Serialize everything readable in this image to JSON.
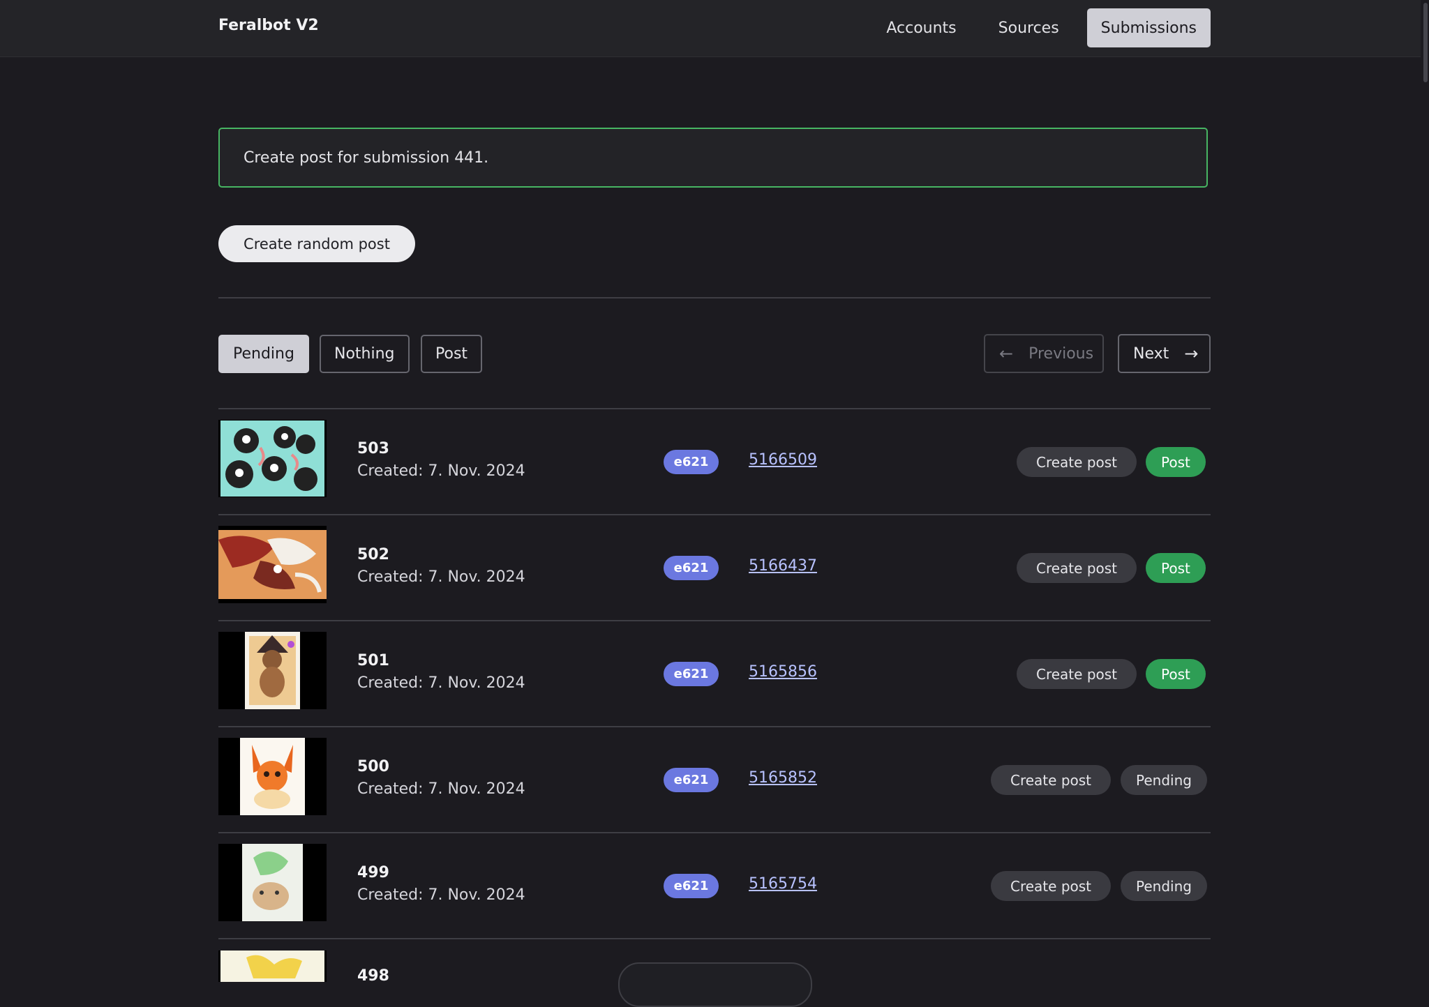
{
  "app": {
    "title": "Feralbot V2"
  },
  "nav": [
    {
      "label": "Accounts",
      "active": false
    },
    {
      "label": "Sources",
      "active": false
    },
    {
      "label": "Submissions",
      "active": true
    }
  ],
  "notice": {
    "text": "Create post for submission 441."
  },
  "actions": {
    "random_post_label": "Create random post"
  },
  "filters": [
    {
      "label": "Pending",
      "active": true
    },
    {
      "label": "Nothing",
      "active": false
    },
    {
      "label": "Post",
      "active": false
    }
  ],
  "pagination": {
    "previous_label": "Previous",
    "next_label": "Next",
    "previous_disabled": true
  },
  "submissions": [
    {
      "id": "503",
      "created": "Created: 7. Nov. 2024",
      "site": "e621",
      "source_id": "5166509",
      "create_label": "Create post",
      "status": "Post"
    },
    {
      "id": "502",
      "created": "Created: 7. Nov. 2024",
      "site": "e621",
      "source_id": "5166437",
      "create_label": "Create post",
      "status": "Post"
    },
    {
      "id": "501",
      "created": "Created: 7. Nov. 2024",
      "site": "e621",
      "source_id": "5165856",
      "create_label": "Create post",
      "status": "Post"
    },
    {
      "id": "500",
      "created": "Created: 7. Nov. 2024",
      "site": "e621",
      "source_id": "5165852",
      "create_label": "Create post",
      "status": "Pending"
    },
    {
      "id": "499",
      "created": "Created: 7. Nov. 2024",
      "site": "e621",
      "source_id": "5165754",
      "create_label": "Create post",
      "status": "Pending"
    },
    {
      "id": "498",
      "created": "",
      "site": "",
      "source_id": "",
      "create_label": "",
      "status": ""
    }
  ],
  "colors": {
    "accent_green": "#2e9e55",
    "badge_blue": "#6b78e0",
    "notice_border": "#47b563",
    "background": "#1c1b20"
  }
}
